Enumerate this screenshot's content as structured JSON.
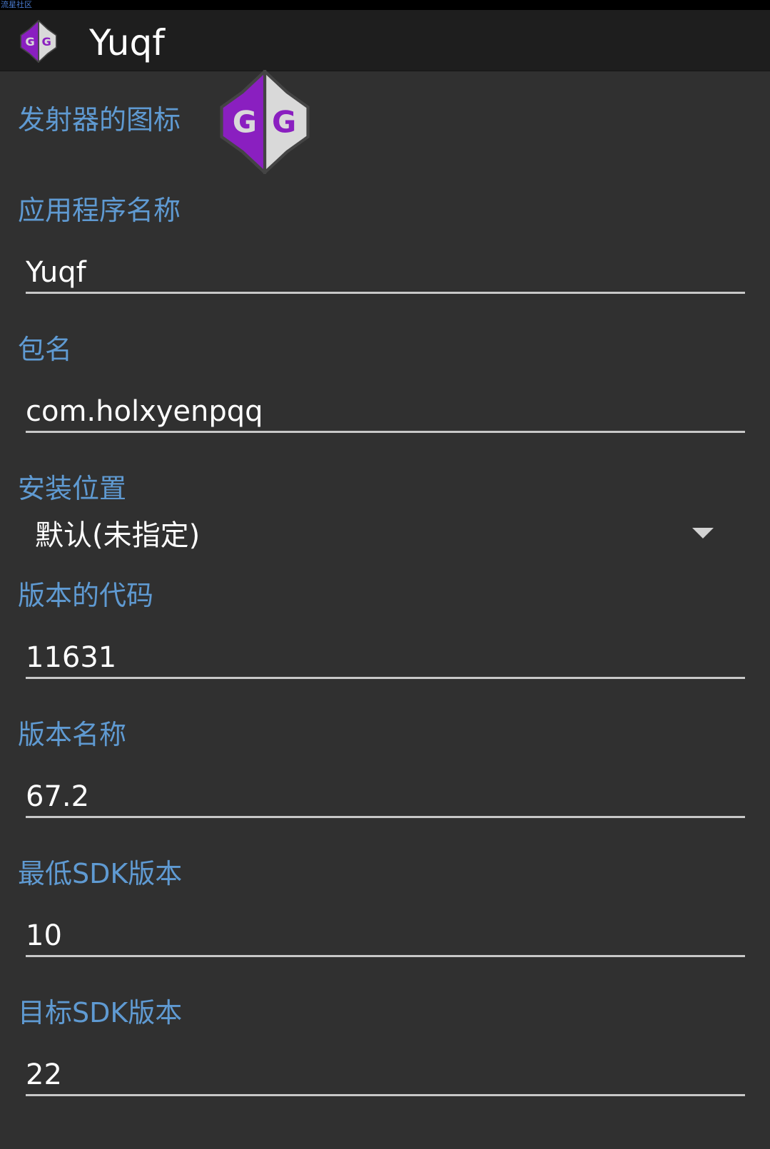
{
  "status_bar": {
    "watermark": "流星社区"
  },
  "app_bar": {
    "title": "Yuqf",
    "icon": "gameguardian-logo-icon"
  },
  "form": {
    "launcher_icon_label": "发射器的图标",
    "launcher_icon": "gameguardian-logo-icon",
    "app_name": {
      "label": "应用程序名称",
      "value": "Yuqf"
    },
    "package_name": {
      "label": "包名",
      "value": "com.holxyenpqq"
    },
    "install_location": {
      "label": "安装位置",
      "value": "默认(未指定)"
    },
    "version_code": {
      "label": "版本的代码",
      "value": "11631"
    },
    "version_name": {
      "label": "版本名称",
      "value": "67.2"
    },
    "min_sdk": {
      "label": "最低SDK版本",
      "value": "10"
    },
    "target_sdk": {
      "label": "目标SDK版本",
      "value": "22"
    }
  },
  "colors": {
    "background": "#303030",
    "app_bar": "#1e1e1e",
    "label": "#5f9ad2",
    "logo_purple": "#8a1fc0",
    "logo_gray": "#d9d9d9"
  }
}
